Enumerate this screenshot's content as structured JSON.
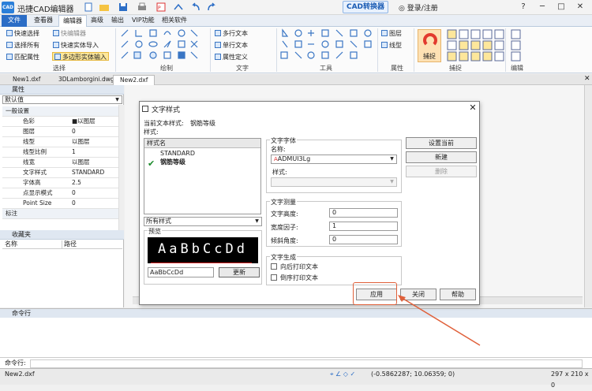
{
  "app": {
    "logo": "CAD",
    "title": "迅捷CAD编辑器",
    "convert_button": "CAD转换器",
    "login": "登录/注册"
  },
  "menu": {
    "file": "文件",
    "tabs": [
      "查看器",
      "编辑器",
      "高级",
      "输出",
      "VIP功能",
      "相关软件"
    ]
  },
  "ribbon": {
    "select_group": {
      "items": [
        "快速选择",
        "选择所有",
        "匹配属性"
      ],
      "items2": [
        "快编辑器",
        "快速实体导入",
        "多边形实体输入"
      ],
      "label": "选择"
    },
    "draw_label": "绘制",
    "text_group": {
      "items": [
        "多行文本",
        "单行文本",
        "属性定义"
      ],
      "label": "文字"
    },
    "tools_label": "工具",
    "attr_group": {
      "items": [
        "图层",
        "线型"
      ],
      "label": "属性"
    },
    "capture": {
      "button": "捕捉",
      "label": "捕捉"
    },
    "edit_label": "编辑"
  },
  "doc_tabs": [
    "New1.dxf",
    "3DLamborgini.dwg",
    "New2.dxf"
  ],
  "properties": {
    "title": "属性",
    "selected": "默认值",
    "general_category": "一般设置",
    "rows": [
      {
        "key": "色彩",
        "value": "■以图层"
      },
      {
        "key": "图层",
        "value": "0"
      },
      {
        "key": "线型",
        "value": "以图层"
      },
      {
        "key": "线型比例",
        "value": "1"
      },
      {
        "key": "线宽",
        "value": "以图层"
      },
      {
        "key": "文字样式",
        "value": "STANDARD"
      },
      {
        "key": "字体高",
        "value": "2.5"
      },
      {
        "key": "点显示模式",
        "value": "0"
      },
      {
        "key": "Point Size",
        "value": "0"
      }
    ],
    "label_category": "标注"
  },
  "favorites": {
    "title": "收藏夹",
    "col_name": "名称",
    "col_path": "路径"
  },
  "command": {
    "title": "命令行",
    "prompt": "命令行:"
  },
  "status": {
    "file": "New2.dxf",
    "coords": "(-0.5862287; 10.06359; 0)",
    "size": "297 x 210 x 0"
  },
  "dialog": {
    "title": "文字样式",
    "current_label": "当前文本样式:",
    "current_value": "钢筋等级",
    "styles_label": "样式:",
    "list_header": "样式名",
    "styles": [
      "STANDARD",
      "钢筋等级"
    ],
    "filter": "所有样式",
    "preview_label": "预览",
    "preview_sample": "AaBbCcDd",
    "preview_input": "AaBbCcDd",
    "update_button": "更新",
    "font_group": "文字字体",
    "font_name_label": "名称:",
    "font_name": "ADMUI3Lg",
    "font_style_label": "样式:",
    "measure_group": "文字测量",
    "height_label": "文字高度:",
    "height_value": "0",
    "width_label": "宽度因子:",
    "width_value": "1",
    "angle_label": "倾斜角度:",
    "angle_value": "0",
    "gen_group": "文字生成",
    "backward": "向后打印文本",
    "upside": "倒序打印文本",
    "set_current": "设置当前",
    "new": "新建",
    "delete": "删除",
    "apply": "应用",
    "close": "关闭",
    "help": "帮助"
  },
  "colors": {
    "accent": "#2b6dc6",
    "highlight": "#e0603a",
    "check": "#1a8a2a"
  }
}
